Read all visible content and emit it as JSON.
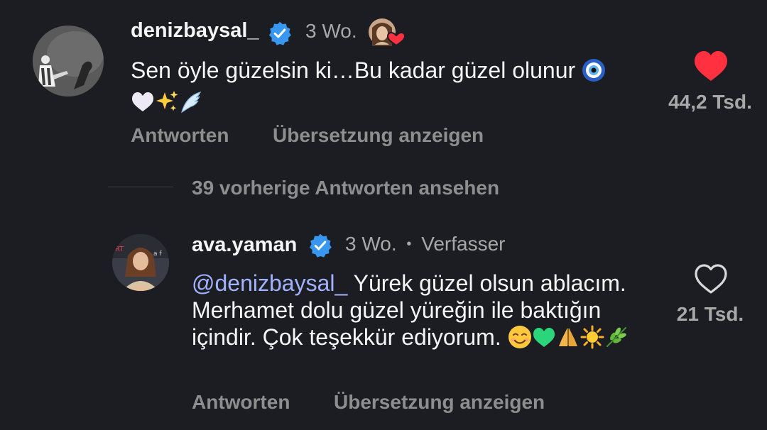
{
  "comments": [
    {
      "username": "denizbaysal_",
      "time": "3 Wo.",
      "text_parts": [
        "Sen öyle güzelsin ki…Bu kadar güzel olunur"
      ],
      "emojis_line1": [
        "nazar-amulet-emoji"
      ],
      "emojis_line2": [
        "white-heart-emoji",
        "sparkles-emoji",
        "wing-emoji"
      ],
      "liked": true,
      "like_count": "44,2 Tsd.",
      "reply_label": "Antworten",
      "translate_label": "Übersetzung anzeigen"
    },
    {
      "username": "ava.yaman",
      "time": "3 Wo.",
      "separator": "•",
      "author_label": "Verfasser",
      "mention": "@denizbaysal_",
      "text": " Yürek güzel olsun ablacım. Merhamet dolu güzel yüreğin ile baktığın içindir. Çok teşekkür ediyorum.",
      "emojis": [
        "smiling-face-emoji",
        "green-heart-emoji",
        "folded-hands-emoji",
        "sun-emoji",
        "herb-emoji"
      ],
      "liked": false,
      "like_count": "21 Tsd.",
      "reply_label": "Antworten",
      "translate_label": "Übersetzung anzeigen"
    }
  ],
  "view_replies_label": "39 vorherige Antworten ansehen",
  "colors": {
    "background": "#1c1d22",
    "verified_blue": "#3897f0",
    "like_red": "#ff3040",
    "mention": "#a1b3ff",
    "secondary_text": "#a8a8a8"
  }
}
